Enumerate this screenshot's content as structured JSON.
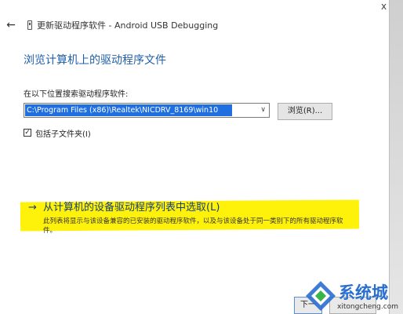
{
  "window": {
    "title": "更新驱动程序软件 - Android USB Debugging",
    "back_icon": "←",
    "close_icon": "x"
  },
  "heading": "浏览计算机上的驱动程序文件",
  "search": {
    "label": "在以下位置搜索驱动程序软件:",
    "path_value": "C:\\Program Files (x86)\\Realtek\\NICDRV_8169\\win10",
    "dropdown_icon": "∨"
  },
  "browse_button": "浏览(R)...",
  "include_subfolders": {
    "label": "包括子文件夹(I)",
    "checked": true,
    "check_glyph": "✓"
  },
  "pick_from_list": {
    "arrow": "→",
    "link": "从计算机的设备驱动程序列表中选取(L)",
    "description": "此列表将显示与该设备兼容的已安装的驱动程序软件，以及与该设备处于同一类别下的所有驱动程序软件。"
  },
  "footer": {
    "next_button": "下一"
  },
  "watermark": {
    "brand": "系统城",
    "domain": "xitongcheng.com"
  },
  "colors": {
    "heading": "#1f5fa8",
    "selection": "#1f6fe0",
    "highlight": "#fff20a",
    "link": "#1a3f7a",
    "watermark": "#2a6fd0"
  }
}
